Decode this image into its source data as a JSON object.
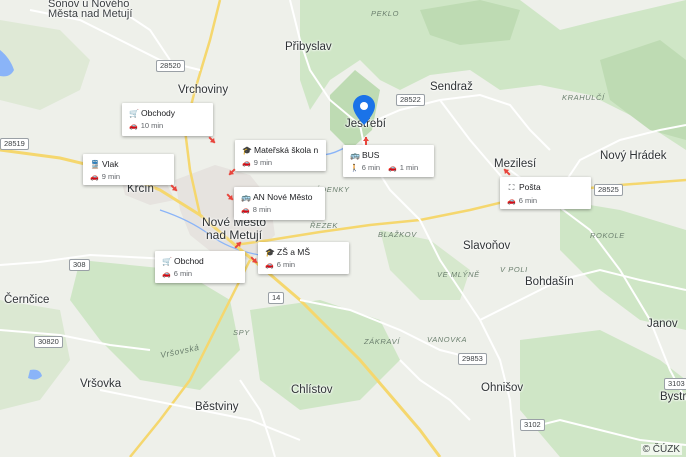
{
  "places": {
    "sonov": "Šonov u Nového",
    "mesta_nad_metuji": "Města nad Metují",
    "pribyslav": "Přibyslav",
    "vrchoviny": "Vrchoviny",
    "jestrebi": "Jestřebí",
    "sendraz": "Sendraž",
    "mezilesi": "Mezilesí",
    "novy_hradek": "Nový Hrádek",
    "krcin": "Krčín",
    "nove_mesto_line1": "Nové Město",
    "nove_mesto_line2": "nad Metují",
    "slavonov": "Slavoňov",
    "bohdasin": "Bohdašín",
    "cernctice": "Černčice",
    "vrsovka": "Vršovka",
    "chlistov": "Chlístov",
    "ohnisov": "Ohnišov",
    "bestviny": "Běstviny",
    "janov": "Janov",
    "bystre": "Bystr"
  },
  "area_labels": {
    "peklo": "PEKLO",
    "krahulci": "KRAHULČÍ",
    "zadenky": "ZÁDENKY",
    "rezek": "ŘEZEK",
    "blazkov": "BLAŽKOV",
    "ve_mlyne": "VE MLÝNĚ",
    "v_poli": "V POLI",
    "rokole": "ROKOLE",
    "zakravi": "ZÁKRAVÍ",
    "vanovka": "VANOVKA",
    "spy": "SPY",
    "vrsovska": "Vršovská"
  },
  "road_numbers": {
    "r28520": "28520",
    "r28522": "28522",
    "r28519": "28519",
    "r28525": "28525",
    "r308": "308",
    "r14": "14",
    "r30820": "30820",
    "r29853": "29853",
    "r3102": "3102",
    "r3103": "3103"
  },
  "cards": [
    {
      "title": "Obchody",
      "icon": "cart-icon",
      "mode": "car",
      "time": "10 min"
    },
    {
      "title": "Mateřská škola n...",
      "icon": "school-icon",
      "mode": "car",
      "time": "9 min"
    },
    {
      "title": "Vlak",
      "icon": "train-icon",
      "mode": "car",
      "time": "9 min"
    },
    {
      "title": "AN Nové Město",
      "icon": "bus-icon",
      "mode": "car",
      "time": "8 min"
    },
    {
      "title": "BUS",
      "icon": "bus-icon",
      "walk_time": "6 min",
      "car_time": "1 min"
    },
    {
      "title": "Pošta",
      "icon": "post-icon",
      "mode": "car",
      "time": "6 min"
    },
    {
      "title": "ZŠ a MŠ",
      "icon": "school-icon",
      "mode": "car",
      "time": "6 min"
    },
    {
      "title": "Obchod",
      "icon": "cart-icon",
      "mode": "car",
      "time": "6 min"
    }
  ],
  "colors": {
    "forest": "#cfe6c6",
    "forest_dark": "#bedbb3",
    "urban": "#e6e3df",
    "road": "#f5d76e",
    "road_minor": "#ffffff",
    "water": "#8ab4f8",
    "pin": "#1a73e8",
    "arrow": "#e8453c"
  },
  "copyright": "© ČÚZK"
}
